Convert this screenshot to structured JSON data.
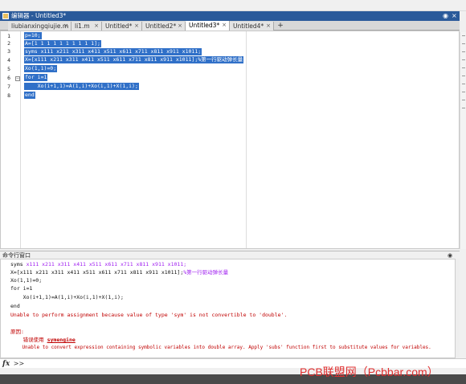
{
  "editor": {
    "title": "编辑器 - Untitled3*",
    "tabs": [
      {
        "label": "liubianxingqiujie.m",
        "active": false
      },
      {
        "label": "li1.m",
        "active": false
      },
      {
        "label": "Untitled*",
        "active": false
      },
      {
        "label": "Untitled2*",
        "active": false
      },
      {
        "label": "Untitled3*",
        "active": true
      },
      {
        "label": "Untitled4*",
        "active": false
      }
    ],
    "add_tab": "+",
    "close_glyph": "×",
    "lines": [
      {
        "n": "1",
        "text": "p=10;"
      },
      {
        "n": "2",
        "text": "A=[1 1 1 1 1 1 1 1 1 1];"
      },
      {
        "n": "3",
        "text": "syms x111 x211 x311 x411 x511 x611 x711 x811 x911 x1011;"
      },
      {
        "n": "4",
        "text": "X=[x111 x211 x311 x411 x511 x611 x711 x811 x911 x1011];%第一行驱动弹长量"
      },
      {
        "n": "5",
        "text": "Xo(1,1)=0;"
      },
      {
        "n": "6",
        "text": "for i=1"
      },
      {
        "n": "7",
        "text": "    Xo(i+1,1)=A(1,i)+Xo(i,1)+X(1,i);"
      },
      {
        "n": "8",
        "text": "end"
      }
    ]
  },
  "command_window": {
    "title": "命令行窗口",
    "lines": [
      {
        "prefix": "syms ",
        "purple": "x111 x211 x311 x411 x511 x611 x711 x811 x911 x1011;",
        "suffix": ""
      },
      {
        "prefix": "X=[x111 x211 x311 x411 x511 x611 x711 x811 x911 x1011];",
        "purple": "%第一行驱动弹长量",
        "suffix": ""
      },
      {
        "prefix": "Xo(1,1)=0;",
        "purple": "",
        "suffix": ""
      },
      {
        "prefix": "for i=1",
        "purple": "",
        "suffix": ""
      },
      {
        "prefix": "    Xo(i+1,1)=A(1,i)+Xo(i,1)+X(1,i);",
        "purple": "",
        "suffix": ""
      },
      {
        "prefix": "end",
        "purple": "",
        "suffix": ""
      }
    ],
    "error_line": "Unable to perform assignment because value of type 'sym' is not convertible to 'double'.",
    "cause_label": "原因:",
    "cause_prefix": "    错误使用 ",
    "cause_link": "symengine",
    "cause_detail": "    Unable to convert expression containing symbolic variables into double array. Apply 'subs' function first to substitute values for variables.",
    "prompt_fx": "fx",
    "prompt_symbol": ">>"
  },
  "watermark": "PCB联盟网（Pcbbar.com）",
  "colors": {
    "selection": "#3070c8",
    "title_bar": "#2a5a9a",
    "error": "#c00000",
    "string_purple": "#a020f0"
  }
}
